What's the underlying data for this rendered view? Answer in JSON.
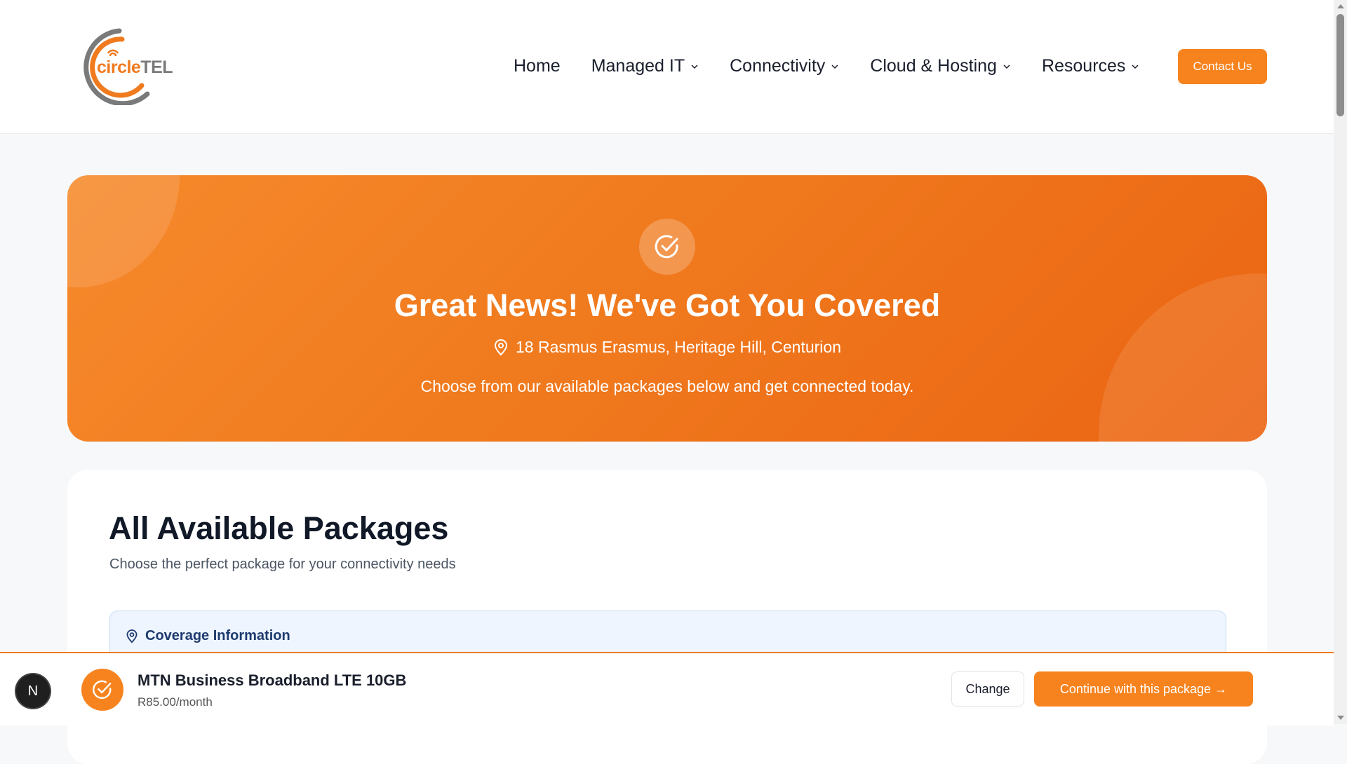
{
  "logo": {
    "part1": "circle",
    "part2": "TEL"
  },
  "nav": {
    "items": [
      {
        "label": "Home",
        "dropdown": false
      },
      {
        "label": "Managed IT",
        "dropdown": true
      },
      {
        "label": "Connectivity",
        "dropdown": true
      },
      {
        "label": "Cloud & Hosting",
        "dropdown": true
      },
      {
        "label": "Resources",
        "dropdown": true
      }
    ],
    "contact_label": "Contact Us"
  },
  "hero": {
    "icon": "check-circle-icon",
    "title": "Great News! We've Got You Covered",
    "address": "18 Rasmus Erasmus, Heritage Hill, Centurion",
    "subtitle": "Choose from our available packages below and get connected today."
  },
  "packages": {
    "title": "All Available Packages",
    "subtitle": "Choose the perfect package for your connectivity needs",
    "coverage_heading": "Coverage Information"
  },
  "selected_package": {
    "name": "MTN Business Broadband LTE 10GB",
    "price": "R85.00/month",
    "change_label": "Change",
    "continue_label": "Continue with this package →"
  },
  "dev_badge": {
    "letter": "N"
  },
  "colors": {
    "accent": "#f7831e",
    "accent_dark": "#eb6412",
    "coverage_bg": "#eef5ff",
    "coverage_text": "#1e3a6e"
  }
}
